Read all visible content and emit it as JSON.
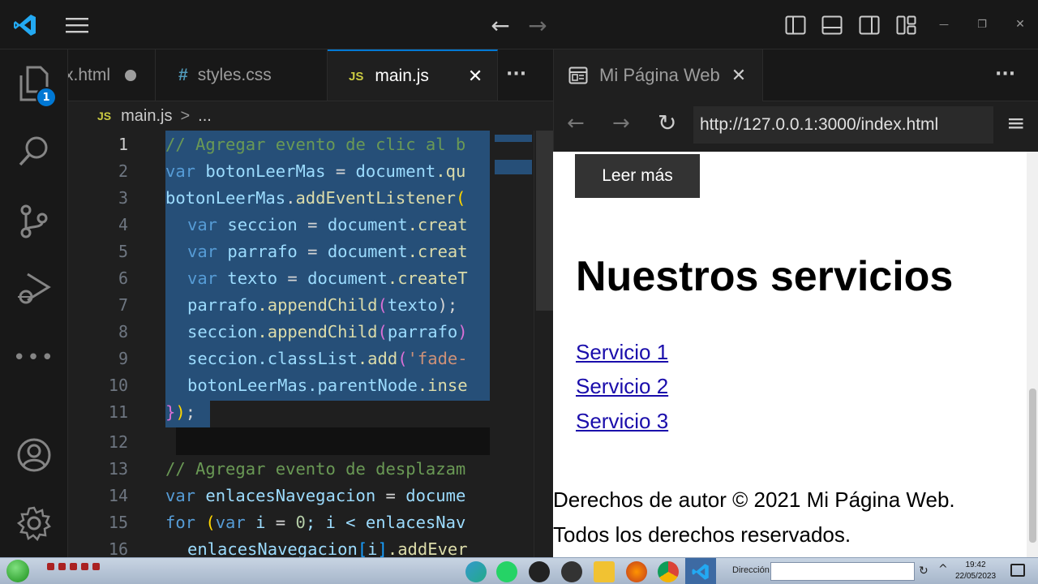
{
  "titlebar": {
    "nav_back": "←",
    "nav_forward": "→",
    "min": "—",
    "restore": "❐",
    "close": "✕"
  },
  "activity": {
    "explorer_badge": "1"
  },
  "tabs": [
    {
      "label": "x.html",
      "icon": "html-file-icon",
      "dirty": true
    },
    {
      "label": "styles.css",
      "icon_text": "#"
    },
    {
      "label": "main.js",
      "icon_text": "JS",
      "active": true,
      "close": "✕"
    }
  ],
  "tabs_more": "···",
  "breadcrumb": {
    "icon_text": "JS",
    "file": "main.js",
    "sep": ">",
    "rest": "..."
  },
  "line_numbers": [
    "1",
    "2",
    "3",
    "4",
    "5",
    "6",
    "7",
    "8",
    "9",
    "10",
    "11",
    "12",
    "13",
    "14",
    "15",
    "16"
  ],
  "code": {
    "l1": "// Agregar evento de clic al b",
    "l2_kw": "var",
    "l2_var": " botonLeerMas",
    "l2_op": " = ",
    "l2_obj": "document",
    "l2_rest": ".qu",
    "l3_obj": "botonLeerMas",
    "l3_dot": ".",
    "l3_fn": "addEventListener",
    "l3_br": "(",
    "l4_kw": "var",
    "l4_var": " seccion",
    "l4_op": " = ",
    "l4_obj": "document",
    "l4_rest": ".creat",
    "l5_kw": "var",
    "l5_var": " parrafo",
    "l5_op": " = ",
    "l5_obj": "document",
    "l5_rest": ".creat",
    "l6_kw": "var",
    "l6_var": " texto",
    "l6_op": " = ",
    "l6_obj": "document",
    "l6_rest": ".createT",
    "l7_obj": "parrafo",
    "l7_fn": ".appendChild",
    "l7_br": "(",
    "l7_arg": "texto",
    "l7_end": ");",
    "l8_obj": "seccion",
    "l8_fn": ".appendChild",
    "l8_br": "(",
    "l8_arg": "parrafo",
    "l8_end": ")",
    "l9_obj": "seccion",
    "l9_p": ".classList",
    "l9_fn": ".add",
    "l9_br": "(",
    "l9_str": "'fade-",
    "l10_obj": "botonLeerMas",
    "l10_p": ".parentNode",
    "l10_fn": ".inse",
    "l11_a": "}",
    "l11_b": ")",
    "l11_c": ";",
    "l13": "// Agregar evento de desplazam",
    "l14_kw": "var",
    "l14_var": " enlacesNavegacion",
    "l14_op": " = ",
    "l14_obj": "docume",
    "l15_kw": "for",
    "l15_br": " (",
    "l15_kw2": "var",
    "l15_var": " i",
    "l15_op": " = ",
    "l15_num": "0",
    "l15_rest": "; i < enlacesNav",
    "l16_obj": "enlacesNavegacion",
    "l16_br": "[",
    "l16_i": "i",
    "l16_br2": "]",
    "l16_fn": ".addEver"
  },
  "panel": {
    "tab_label": "Mi Página Web",
    "tab_close": "✕",
    "more": "···",
    "back": "←",
    "forward": "→",
    "reload": "↻",
    "url": "http://127.0.0.1:3000/index.html",
    "menu": "≡"
  },
  "page": {
    "button": "Leer más",
    "heading": "Nuestros servicios",
    "links": [
      "Servicio 1",
      "Servicio 2",
      "Servicio 3"
    ],
    "footer1": "Derechos de autor © 2021 Mi Página Web.",
    "footer2": "Todos los derechos reservados."
  },
  "taskbar": {
    "address_label": "Dirección",
    "time": "19:42",
    "date": "22/05/2023"
  },
  "colors": {
    "accent": "#0078d4",
    "selection": "#264f78",
    "link": "#1a0dab"
  }
}
